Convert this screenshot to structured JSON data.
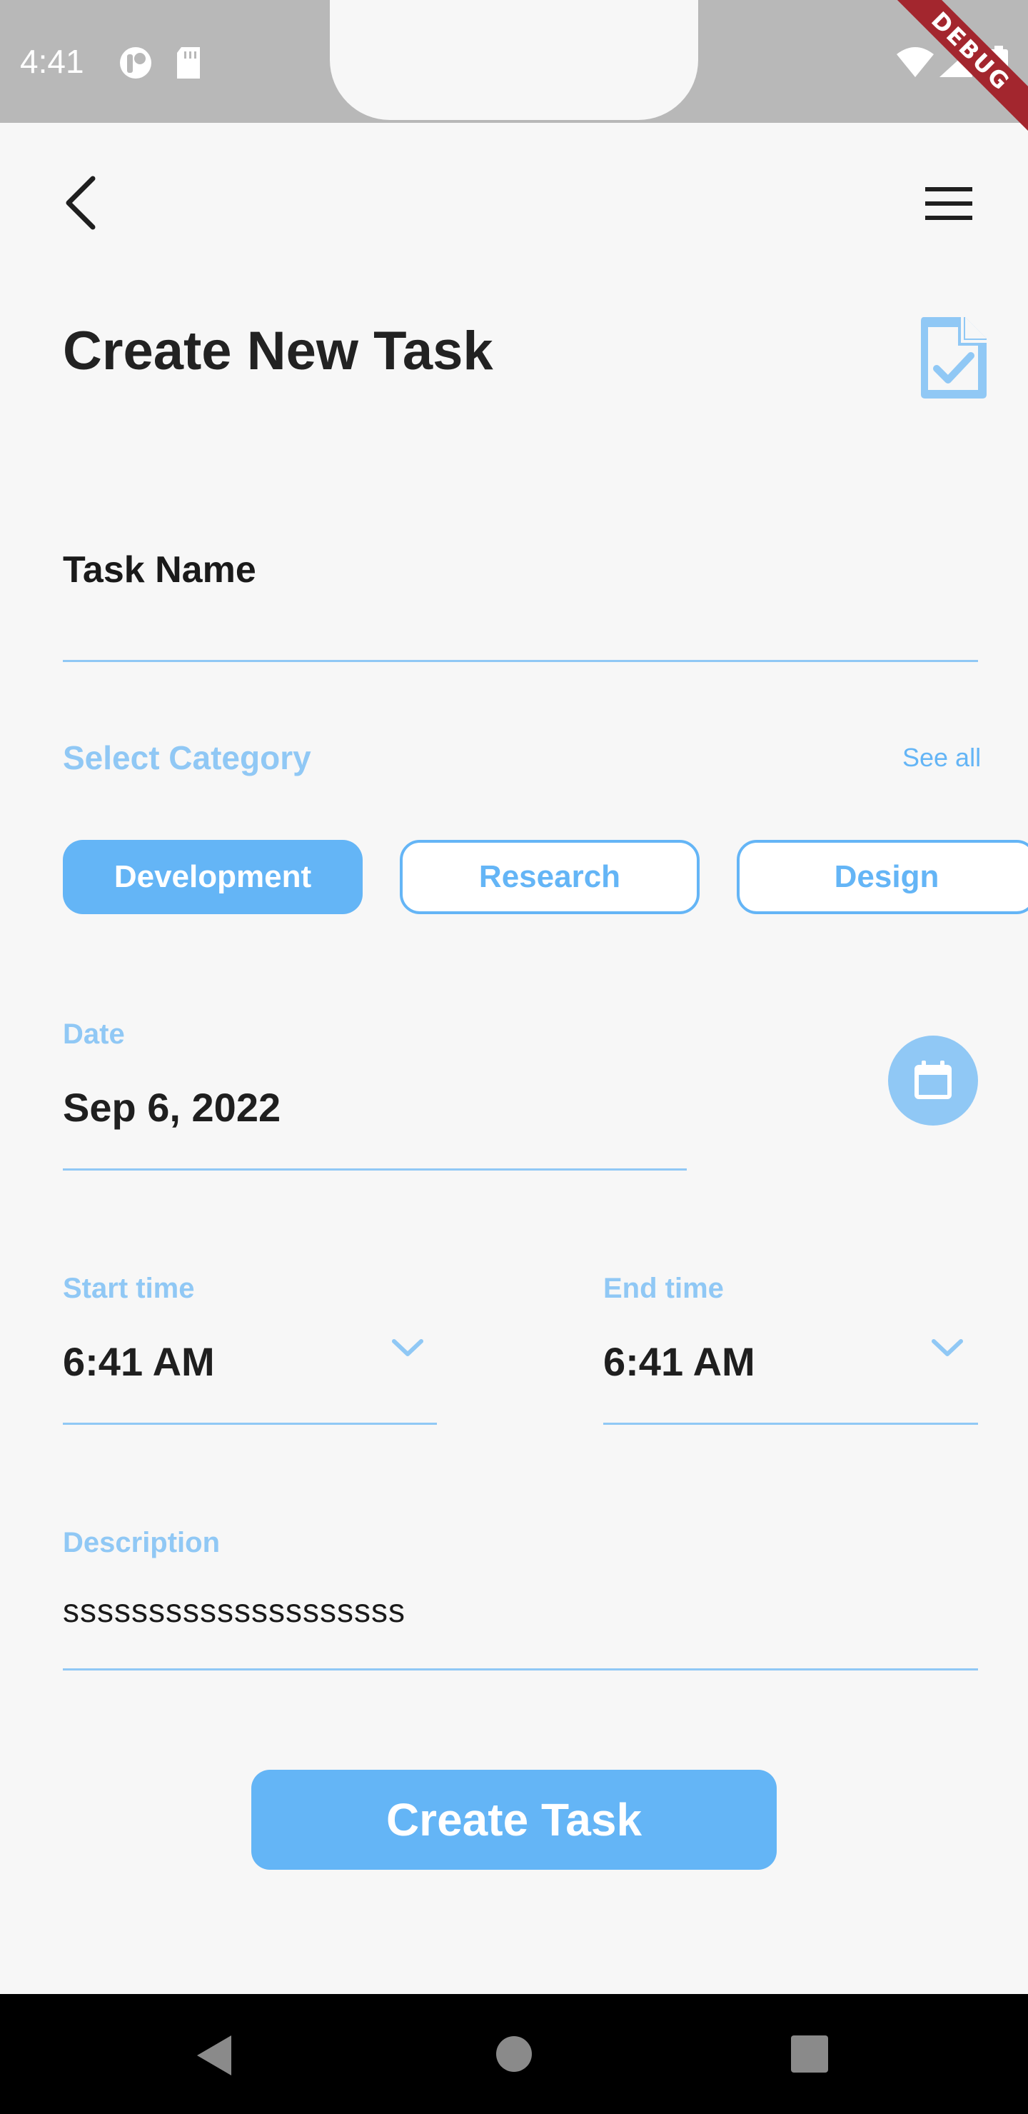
{
  "status_bar": {
    "time": "4:41",
    "icons": [
      "pin-icon",
      "sd-card-icon",
      "wifi-icon",
      "signal-icon",
      "battery-icon"
    ],
    "debug_label": "DEBUG"
  },
  "app_bar": {
    "back_icon": "back-arrow-icon",
    "menu_icon": "hamburger-menu-icon"
  },
  "page": {
    "title": "Create New Task",
    "title_icon": "task-document-check-icon"
  },
  "form": {
    "task_name_label": "Task Name",
    "task_name_value": "",
    "category_title": "Select Category",
    "see_all": "See all",
    "categories": [
      {
        "label": "Development",
        "selected": true
      },
      {
        "label": "Research",
        "selected": false
      },
      {
        "label": "Design",
        "selected": false
      }
    ],
    "date_label": "Date",
    "date_value": "Sep 6, 2022",
    "start_time_label": "Start time",
    "start_time_value": "6:41 AM",
    "end_time_label": "End time",
    "end_time_value": "6:41 AM",
    "description_label": "Description",
    "description_value": "ssssssssssssssssssss"
  },
  "actions": {
    "create_label": "Create Task"
  },
  "colors": {
    "accent": "#64b5f6",
    "accent_light": "#90c8f5",
    "background": "#f7f7f7",
    "status_bar": "#b8b8b8",
    "debug_ribbon": "#a3262e"
  }
}
